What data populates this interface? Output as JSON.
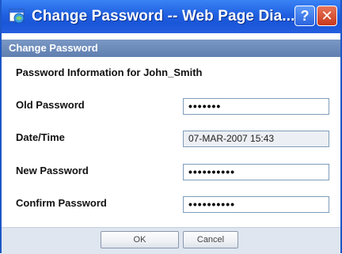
{
  "window": {
    "title": "Change Password -- Web Page Dia...",
    "help_label": "?",
    "close_label": "✕"
  },
  "section": {
    "header": "Change Password",
    "info": "Password Information for John_Smith"
  },
  "fields": {
    "old_password": {
      "label": "Old Password",
      "value": "•••••••"
    },
    "datetime": {
      "label": "Date/Time",
      "value": "07-MAR-2007 15:43"
    },
    "new_password": {
      "label": "New Password",
      "value": "••••••••••"
    },
    "confirm_password": {
      "label": "Confirm Password",
      "value": "••••••••••"
    }
  },
  "buttons": {
    "ok": "OK",
    "cancel": "Cancel"
  },
  "colors": {
    "titlebar": "#1f5fe0",
    "section_header": "#6a88b8",
    "footer": "#dfe6ef"
  }
}
